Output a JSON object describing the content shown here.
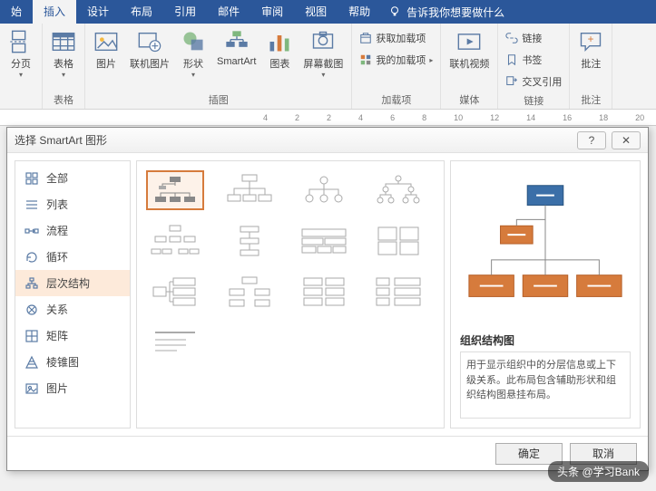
{
  "ribbon": {
    "tabs": [
      "始",
      "插入",
      "设计",
      "布局",
      "引用",
      "邮件",
      "审阅",
      "视图",
      "帮助"
    ],
    "active_tab": "插入",
    "tell_me": "告诉我你想要做什么",
    "groups": {
      "pages": {
        "label": "",
        "items": {
          "page_break": "分页"
        }
      },
      "tables": {
        "label": "表格",
        "items": {
          "table": "表格"
        }
      },
      "illustrations": {
        "label": "插图",
        "items": {
          "picture": "图片",
          "online_pic": "联机图片",
          "shapes": "形状",
          "smartart": "SmartArt",
          "chart": "图表",
          "screenshot": "屏幕截图"
        }
      },
      "addins": {
        "label": "加载项",
        "items": {
          "get": "获取加载项",
          "my": "我的加载项"
        }
      },
      "media": {
        "label": "媒体",
        "items": {
          "video": "联机视频"
        }
      },
      "links": {
        "label": "链接",
        "items": {
          "link": "链接",
          "bookmark": "书签",
          "crossref": "交叉引用"
        }
      },
      "comments": {
        "label": "批注",
        "items": {
          "comment": "批注"
        }
      }
    }
  },
  "ruler": {
    "marks": [
      "4",
      "2",
      "2",
      "4",
      "6",
      "8",
      "10",
      "12",
      "14",
      "16",
      "18",
      "20"
    ]
  },
  "dialog": {
    "title": "选择 SmartArt 图形",
    "help": "?",
    "close": "✕",
    "categories": [
      {
        "key": "all",
        "label": "全部"
      },
      {
        "key": "list",
        "label": "列表"
      },
      {
        "key": "process",
        "label": "流程"
      },
      {
        "key": "cycle",
        "label": "循环"
      },
      {
        "key": "hierarchy",
        "label": "层次结构"
      },
      {
        "key": "relationship",
        "label": "关系"
      },
      {
        "key": "matrix",
        "label": "矩阵"
      },
      {
        "key": "pyramid",
        "label": "棱锥图"
      },
      {
        "key": "picture",
        "label": "图片"
      }
    ],
    "selected_category": "hierarchy",
    "preview": {
      "title": "组织结构图",
      "desc": "用于显示组织中的分层信息或上下级关系。此布局包含辅助形状和组织结构图悬挂布局。"
    },
    "buttons": {
      "ok": "确定",
      "cancel": "取消"
    }
  },
  "watermark": "头条 @学习Bank"
}
